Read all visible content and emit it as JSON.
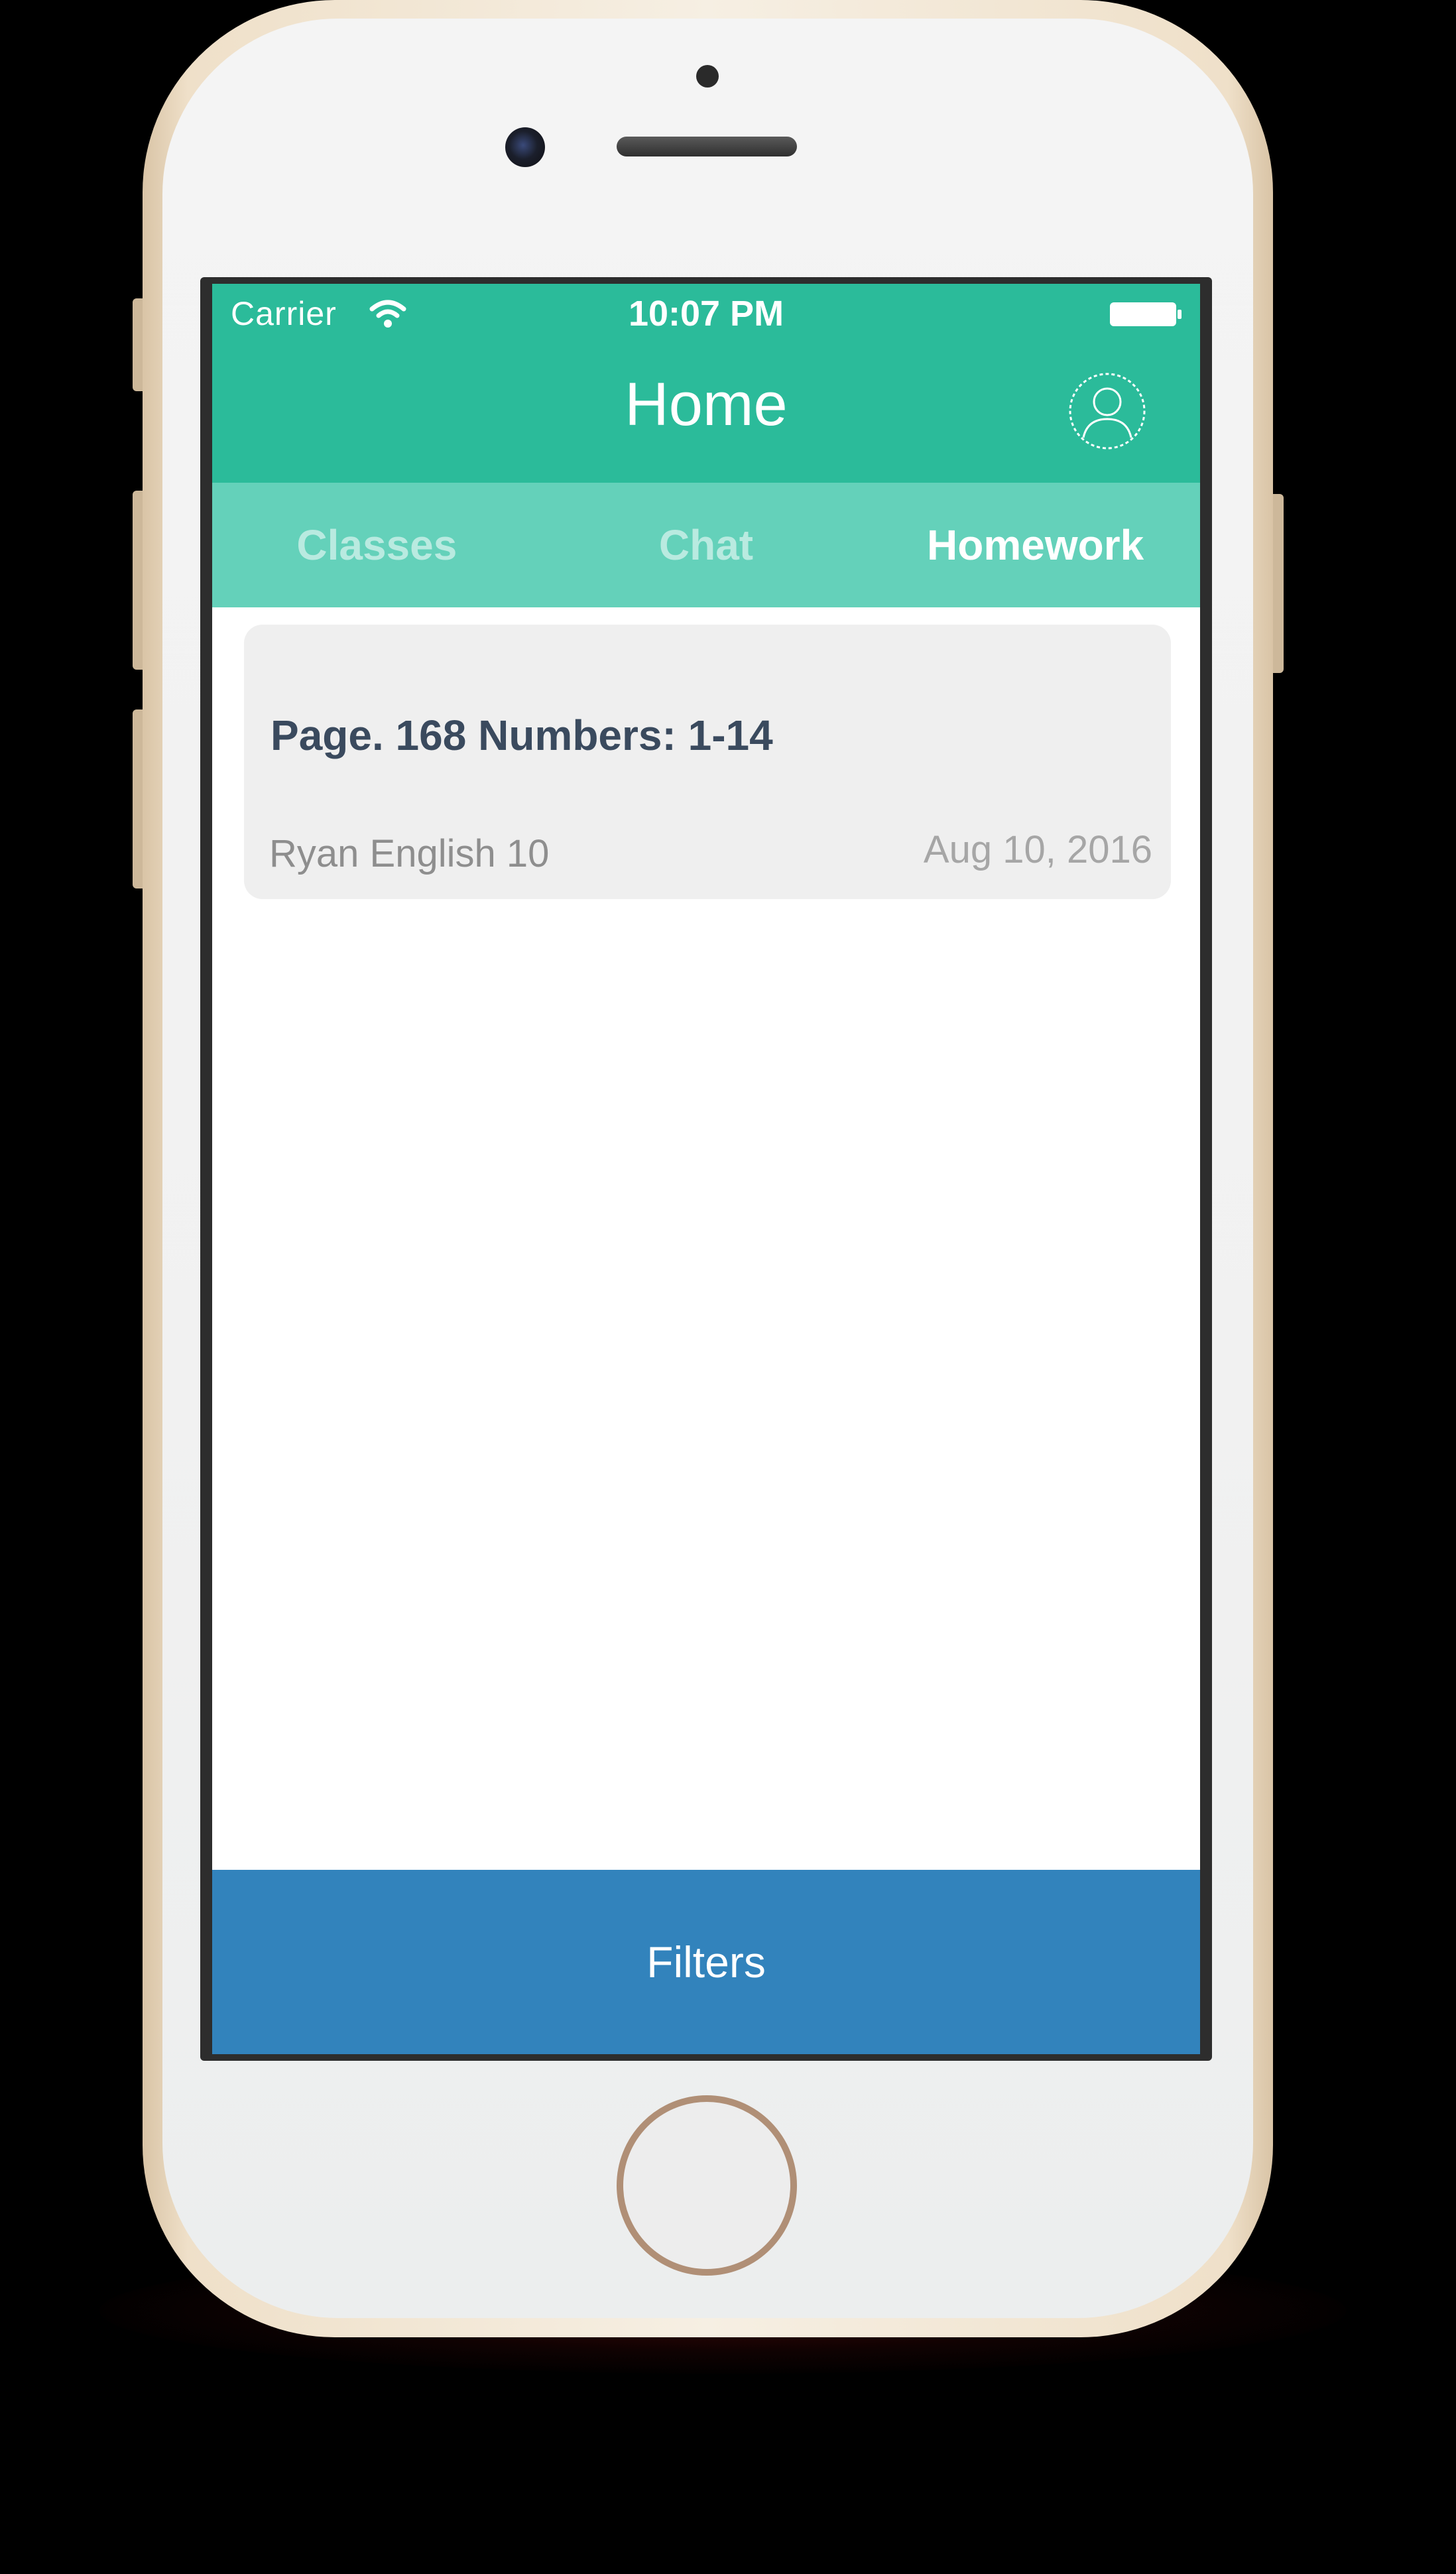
{
  "status_bar": {
    "carrier": "Carrier",
    "time": "10:07 PM"
  },
  "header": {
    "title": "Home",
    "profile_icon": "profile-icon"
  },
  "tabs": [
    {
      "label": "Classes",
      "active": false
    },
    {
      "label": "Chat",
      "active": false
    },
    {
      "label": "Homework",
      "active": true
    }
  ],
  "homework": [
    {
      "title": "Page. 168 Numbers: 1-14",
      "class": "Ryan English 10",
      "date": "Aug 10, 2016"
    }
  ],
  "footer": {
    "filters_label": "Filters"
  },
  "colors": {
    "header": "#2bbb9a",
    "tabs": "#64d1ba",
    "filters": "#3283bc",
    "card": "#efefef"
  }
}
